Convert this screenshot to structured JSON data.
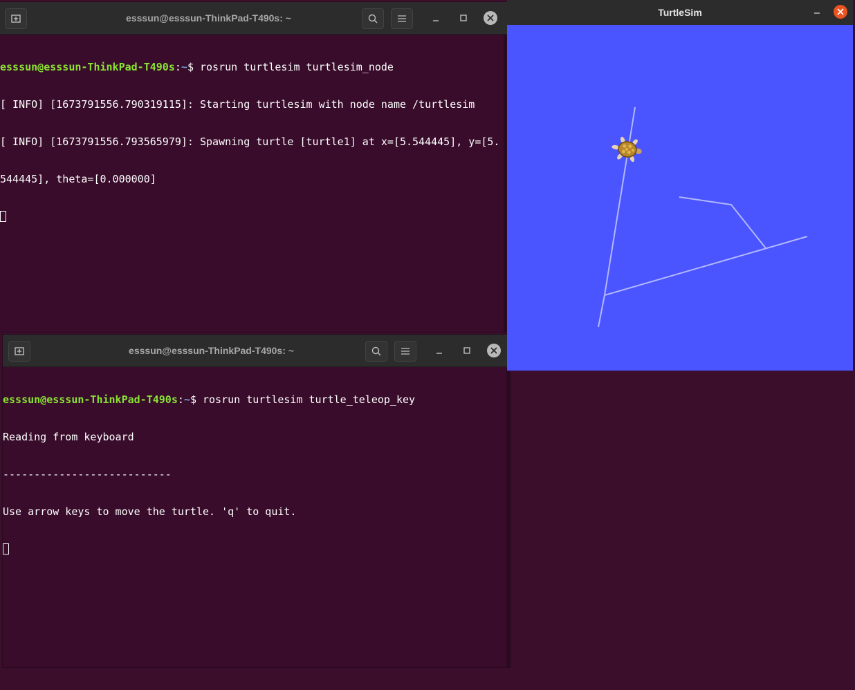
{
  "terminal1": {
    "title": "esssun@esssun-ThinkPad-T490s: ~",
    "prompt_user": "esssun@esssun-ThinkPad-T490s",
    "prompt_sep": ":",
    "prompt_path": "~",
    "prompt_end": "$ ",
    "command": "rosrun turtlesim turtlesim_node",
    "output": [
      "[ INFO] [1673791556.790319115]: Starting turtlesim with node name /turtlesim",
      "[ INFO] [1673791556.793565979]: Spawning turtle [turtle1] at x=[5.544445], y=[5.",
      "544445], theta=[0.000000]"
    ]
  },
  "terminal2": {
    "title": "esssun@esssun-ThinkPad-T490s: ~",
    "prompt_user": "esssun@esssun-ThinkPad-T490s",
    "prompt_sep": ":",
    "prompt_path": "~",
    "prompt_end": "$ ",
    "command": "rosrun turtlesim turtle_teleop_key",
    "output": [
      "Reading from keyboard",
      "---------------------------",
      "Use arrow keys to move the turtle. 'q' to quit."
    ]
  },
  "turtlesim": {
    "title": "TurtleSim",
    "background_color": "#4a55ff",
    "pen_color": "#b3b8ff",
    "turtle_icon": "turtle-icon"
  },
  "icons": {
    "new_tab": "new-tab-icon",
    "search": "search-icon",
    "menu": "hamburger-menu-icon",
    "minimize": "minimize-icon",
    "maximize": "maximize-icon",
    "close": "close-icon"
  }
}
